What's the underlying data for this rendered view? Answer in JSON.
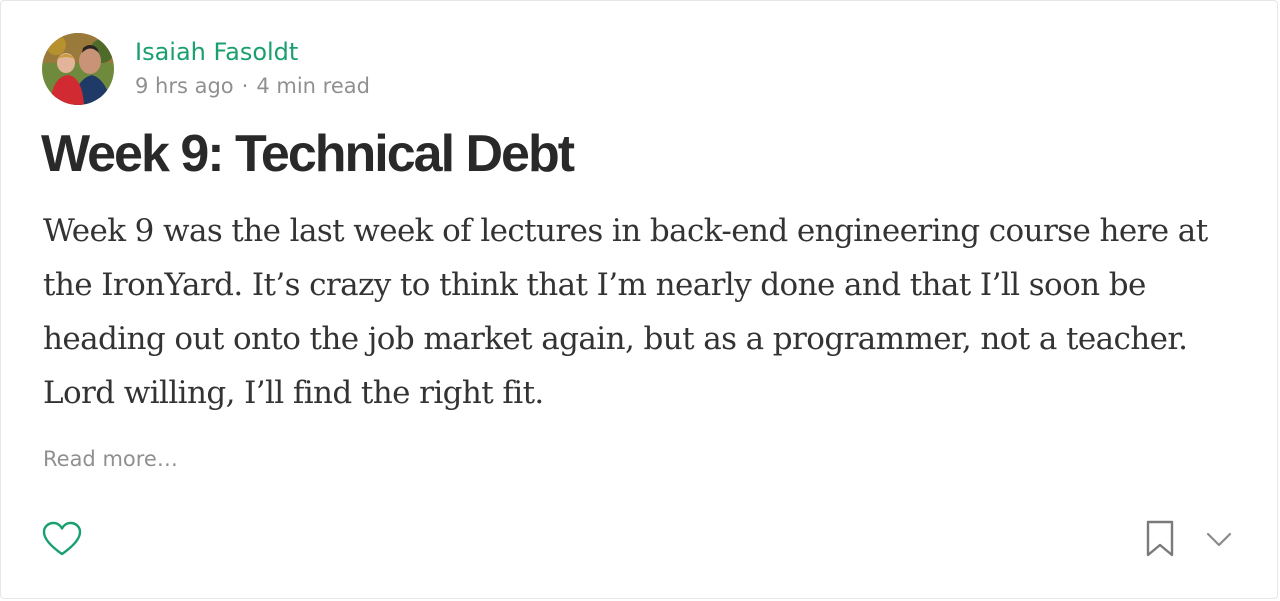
{
  "post": {
    "author": {
      "name": "Isaiah Fasoldt",
      "avatar_icon": "author-avatar-photo"
    },
    "meta": {
      "time_ago": "9 hrs ago",
      "separator": "·",
      "read_time": "4 min read"
    },
    "title": "Week 9: Technical Debt",
    "excerpt": "Week 9 was the last week of lectures in back-end engineering course here at the IronYard. It’s crazy to think that I’m nearly done and that I’ll soon be heading out onto the job market again, but as a programmer, not a teacher. Lord willing, I’ll find the right fit.",
    "read_more": "Read more…"
  },
  "actions": {
    "like_icon": "heart-icon",
    "bookmark_icon": "bookmark-icon",
    "more_icon": "chevron-down-icon"
  },
  "colors": {
    "accent": "#1a9f6f",
    "muted_text": "#8f8f8f",
    "border": "#e6e6e6"
  }
}
